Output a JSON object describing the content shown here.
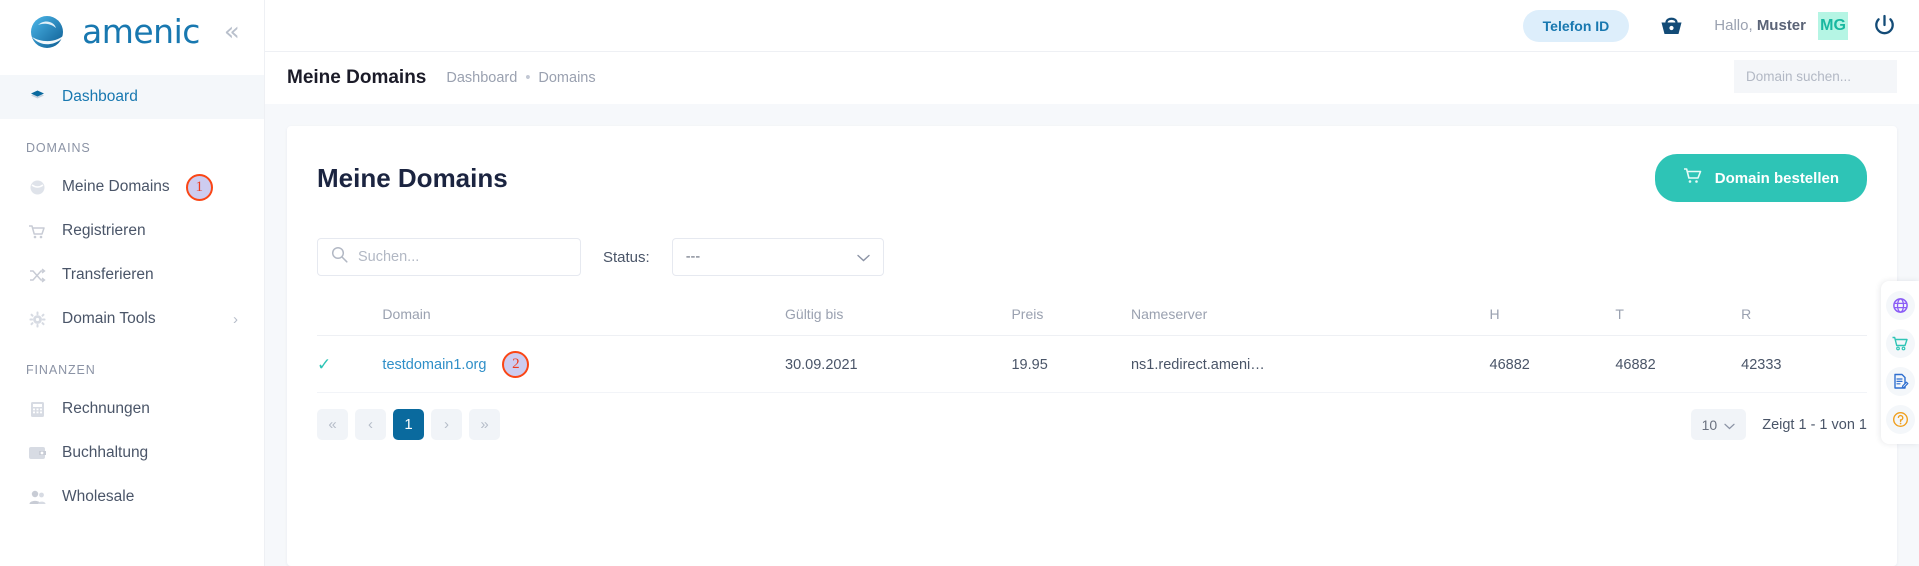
{
  "brand": {
    "name": "amenic",
    "collapse_icon": "chevrons-left-icon"
  },
  "sidebar": {
    "primary": [
      {
        "label": "Dashboard",
        "icon": "diamond-icon",
        "active": true
      }
    ],
    "groups": [
      {
        "title": "DOMAINS",
        "items": [
          {
            "label": "Meine Domains",
            "icon": "globe-icon",
            "marker": "1"
          },
          {
            "label": "Registrieren",
            "icon": "cart-icon"
          },
          {
            "label": "Transferieren",
            "icon": "shuffle-icon"
          },
          {
            "label": "Domain Tools",
            "icon": "gear-icon",
            "chevron": "›"
          }
        ]
      },
      {
        "title": "FINANZEN",
        "items": [
          {
            "label": "Rechnungen",
            "icon": "calculator-icon"
          },
          {
            "label": "Buchhaltung",
            "icon": "wallet-icon"
          },
          {
            "label": "Wholesale",
            "icon": "users-icon"
          }
        ]
      }
    ]
  },
  "topbar": {
    "phone_id_label": "Telefon ID",
    "cart_icon": "basket-icon",
    "greeting_prefix": "Hallo, ",
    "greeting_name": "Muster",
    "avatar_initials": "MG",
    "power_icon": "power-icon"
  },
  "subbar": {
    "page_title": "Meine Domains",
    "breadcrumb": {
      "root": "Dashboard",
      "separator": "•",
      "current": "Domains"
    },
    "search": {
      "placeholder": "Domain suchen...",
      "value": "",
      "icon": "search-icon"
    }
  },
  "card": {
    "title": "Meine Domains",
    "order_button": {
      "label": "Domain bestellen",
      "icon": "cart-icon"
    },
    "filters": {
      "search": {
        "placeholder": "Suchen...",
        "value": "",
        "icon": "search-icon"
      },
      "status_label": "Status:",
      "status_value": "---",
      "status_chevron": "chevron-down-icon"
    },
    "table": {
      "columns": [
        "",
        "Domain",
        "Gültig bis",
        "Preis",
        "Nameserver",
        "H",
        "T",
        "R"
      ],
      "rows": [
        {
          "checked": "✓",
          "domain": "testdomain1.org",
          "marker": "2",
          "valid_until": "30.09.2021",
          "price": "19.95",
          "nameserver": "ns1.redirect.ameni…",
          "h": "46882",
          "t": "46882",
          "r": "42333"
        }
      ]
    },
    "pagination": {
      "first": "«",
      "prev": "‹",
      "pages": [
        "1"
      ],
      "current_page": "1",
      "next": "›",
      "last": "»",
      "per_page": "10",
      "per_page_chevron": "chevron-down-icon",
      "showing": "Zeigt 1 - 1 von 1"
    }
  },
  "rail": {
    "buttons": [
      {
        "icon": "globe-icon",
        "color": "#8b5cf6"
      },
      {
        "icon": "cart-icon",
        "color": "#2ec4b6"
      },
      {
        "icon": "document-edit-icon",
        "color": "#2f6fd0"
      },
      {
        "icon": "help-circle-icon",
        "color": "#f0a020"
      }
    ]
  },
  "colors": {
    "brand_blue": "#1878b0",
    "accent_teal": "#2ec4b6",
    "page_bg": "#f6f8fb",
    "marker_border": "#fa4616",
    "marker_fill": "#cdccf0"
  }
}
